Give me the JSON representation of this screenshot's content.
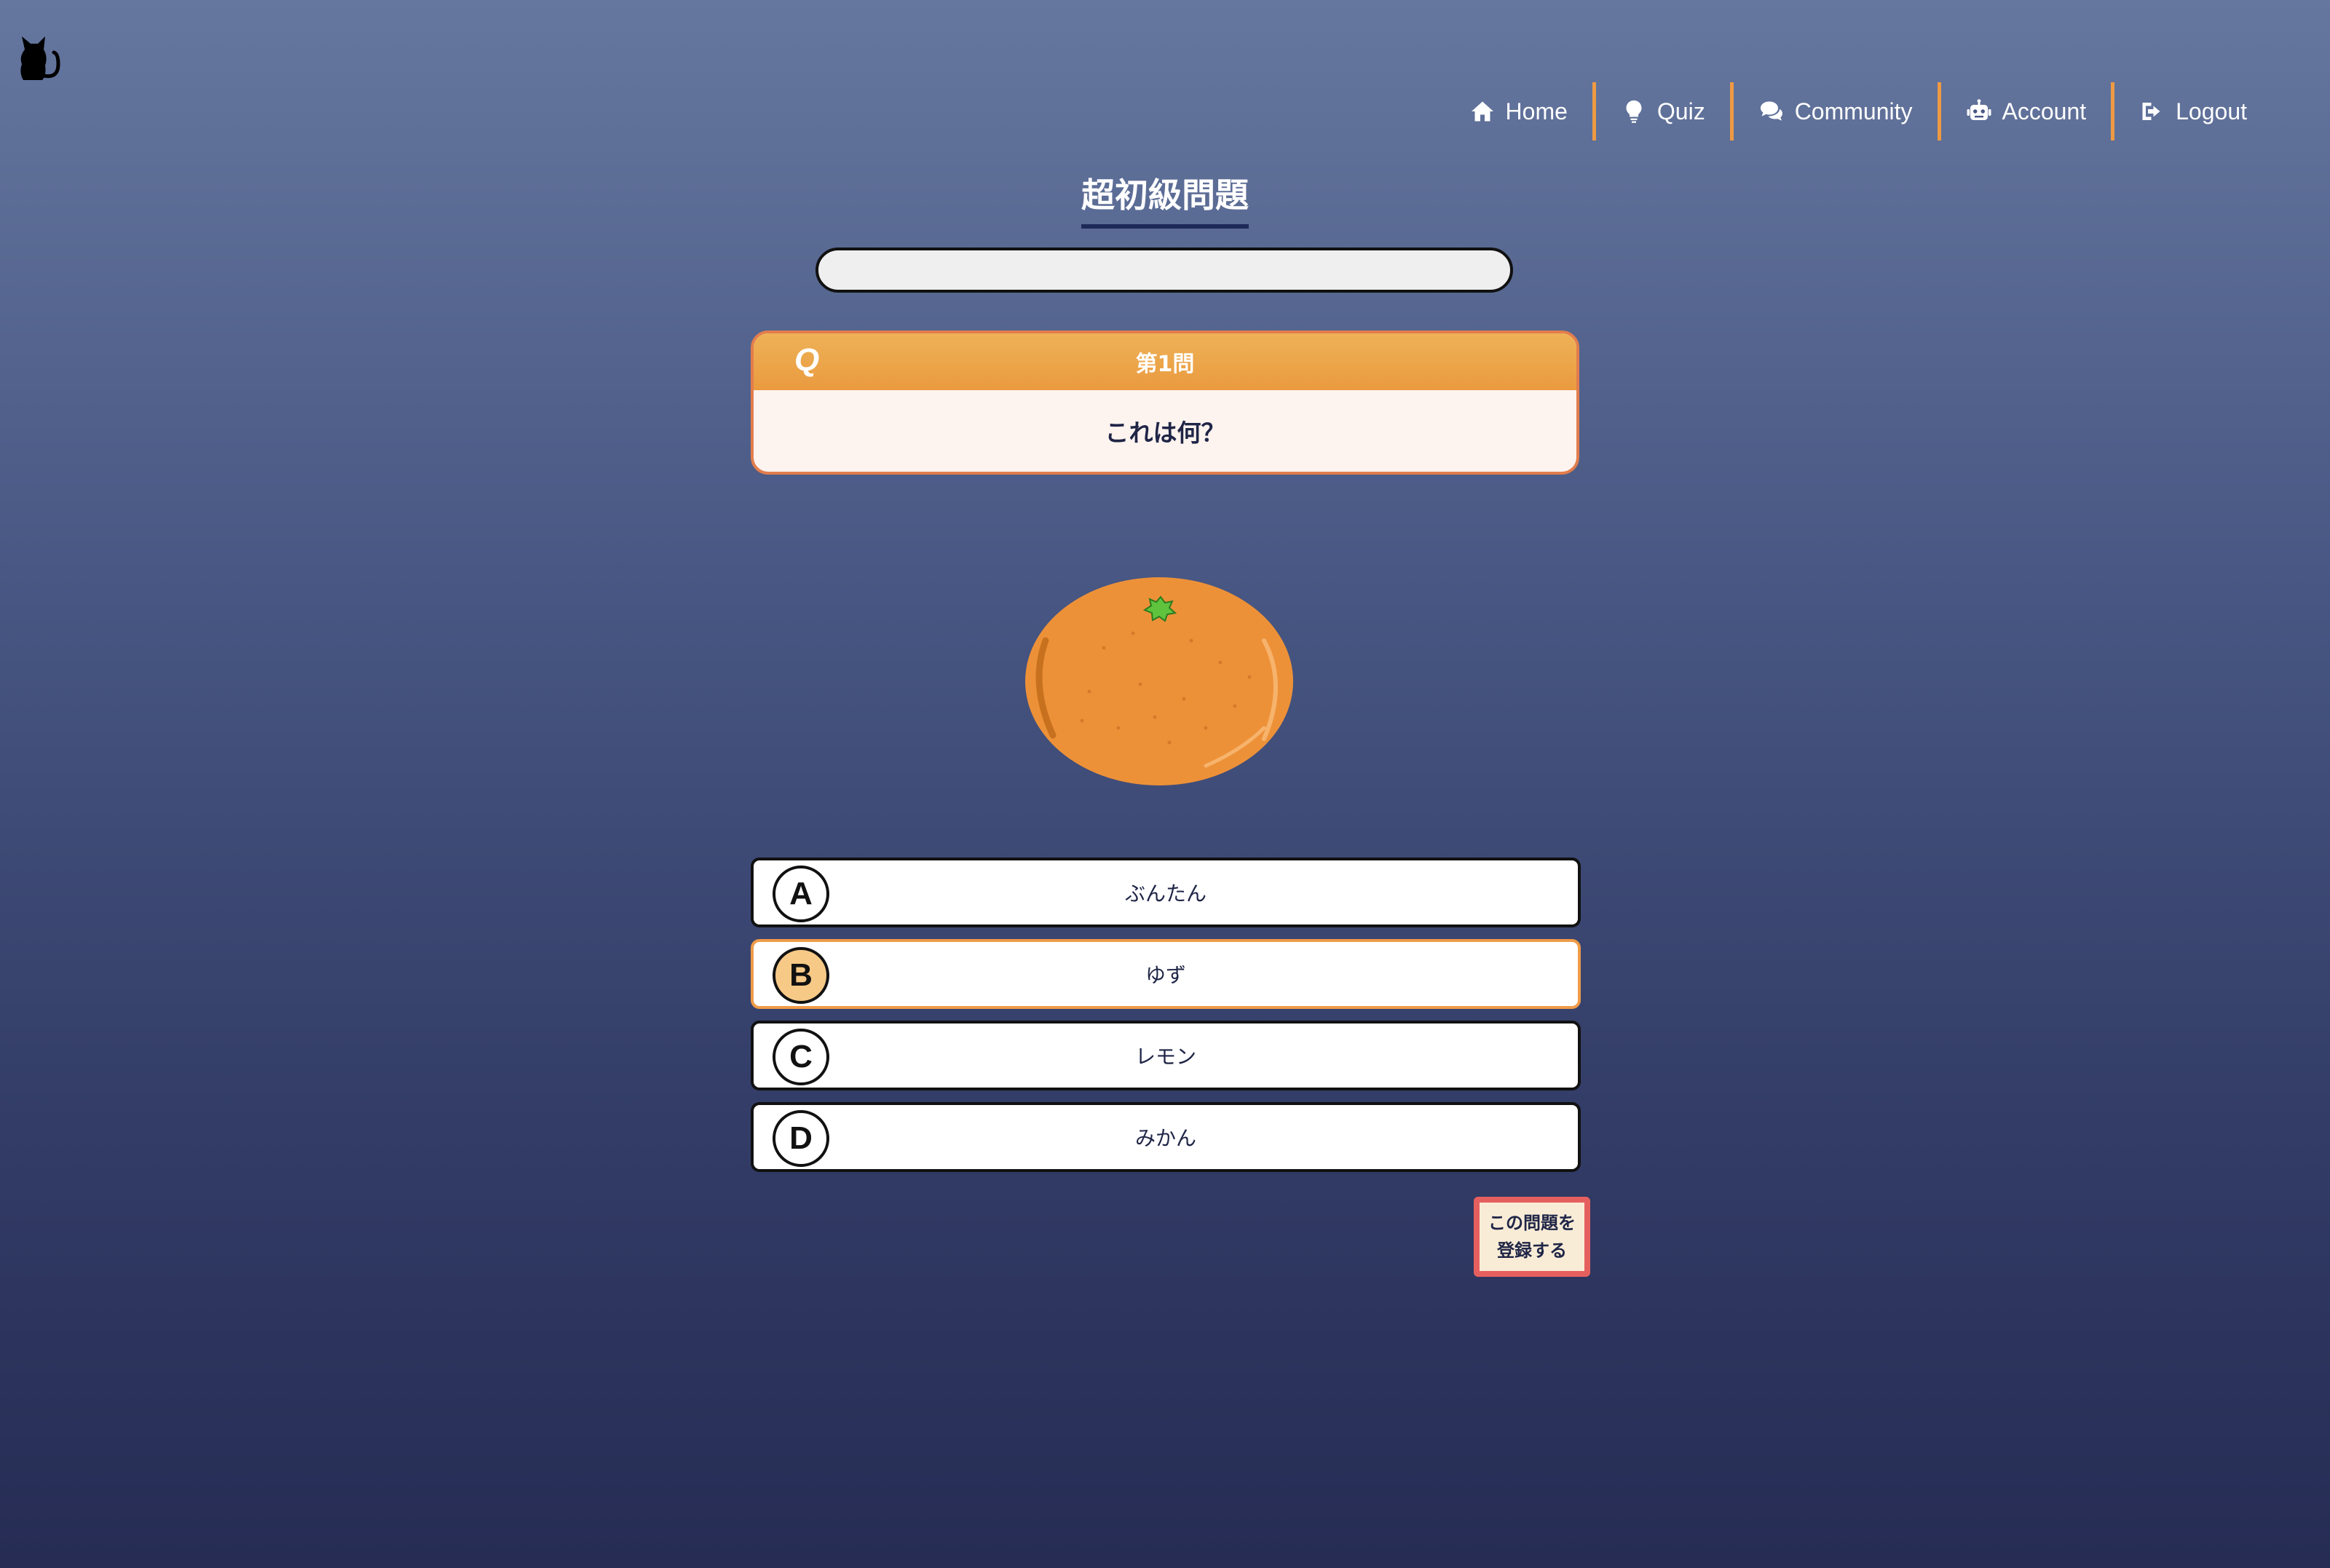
{
  "nav": {
    "items": [
      {
        "label": "Home",
        "icon": "home-icon"
      },
      {
        "label": "Quiz",
        "icon": "lightbulb-icon"
      },
      {
        "label": "Community",
        "icon": "comments-icon"
      },
      {
        "label": "Account",
        "icon": "robot-icon"
      },
      {
        "label": "Logout",
        "icon": "sign-out-icon"
      }
    ]
  },
  "quiz": {
    "title": "超初級問題",
    "progress_fraction": 0,
    "question": {
      "badge": "Q",
      "number_label": "第1問",
      "text": "これは何？"
    },
    "image_icon": "mandarin-orange-icon",
    "choices": [
      {
        "letter": "A",
        "text": "ぶんたん",
        "selected": false
      },
      {
        "letter": "B",
        "text": "ゆず",
        "selected": true
      },
      {
        "letter": "C",
        "text": "レモン",
        "selected": false
      },
      {
        "letter": "D",
        "text": "みかん",
        "selected": false
      }
    ],
    "register_button": {
      "line1": "この問題を",
      "line2": "登録する"
    }
  },
  "colors": {
    "accent": "#ee9a43",
    "selected_letter_bg": "#f6c987",
    "register_border": "#e65f5f",
    "background_top": "#65779f",
    "background_bottom": "#262c54"
  }
}
